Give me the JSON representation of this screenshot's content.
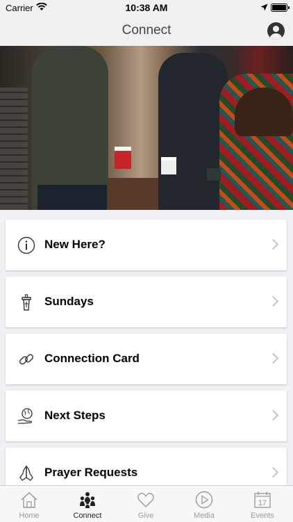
{
  "status_bar": {
    "carrier": "Carrier",
    "time": "10:38 AM"
  },
  "nav": {
    "title": "Connect"
  },
  "hero": {
    "description_icon": "photo"
  },
  "menu": [
    {
      "label": "New Here?",
      "icon": "info-icon"
    },
    {
      "label": "Sundays",
      "icon": "pulpit-icon"
    },
    {
      "label": "Connection Card",
      "icon": "link-icon"
    },
    {
      "label": "Next Steps",
      "icon": "globe-hand-icon"
    },
    {
      "label": "Prayer Requests",
      "icon": "praying-hands-icon"
    }
  ],
  "tabs": [
    {
      "label": "Home",
      "active": false
    },
    {
      "label": "Connect",
      "active": true
    },
    {
      "label": "Give",
      "active": false
    },
    {
      "label": "Media",
      "active": false
    },
    {
      "label": "Events",
      "active": false,
      "calendar_day": "17"
    }
  ],
  "colors": {
    "accent": "#222222",
    "inactive_tab": "#9a9a9e",
    "chevron": "#c4c4c8"
  }
}
